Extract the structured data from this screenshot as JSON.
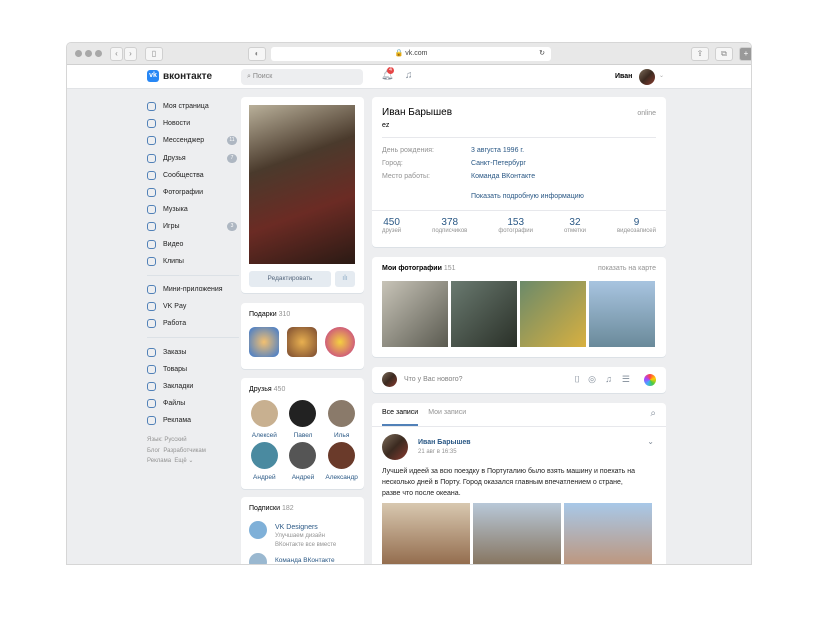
{
  "browser": {
    "url": "vk.com"
  },
  "header": {
    "logo": "вконтакте",
    "search_placeholder": "Поиск",
    "notifications": "4",
    "user": "Иван"
  },
  "sidebar": {
    "items": [
      {
        "label": "Моя страница"
      },
      {
        "label": "Новости"
      },
      {
        "label": "Мессенджер",
        "count": "11"
      },
      {
        "label": "Друзья",
        "count": "7"
      },
      {
        "label": "Сообщества"
      },
      {
        "label": "Фотографии"
      },
      {
        "label": "Музыка"
      },
      {
        "label": "Игры",
        "count": "3"
      },
      {
        "label": "Видео"
      },
      {
        "label": "Клипы"
      }
    ],
    "items2": [
      {
        "label": "Мини-приложения"
      },
      {
        "label": "VK Pay"
      },
      {
        "label": "Работа"
      }
    ],
    "items3": [
      {
        "label": "Заказы"
      },
      {
        "label": "Товары"
      },
      {
        "label": "Закладки"
      },
      {
        "label": "Файлы"
      },
      {
        "label": "Реклама"
      }
    ],
    "footer": {
      "lang": "Язык: Русский",
      "blog": "Блог",
      "dev": "Разработчикам",
      "ads": "Реклама",
      "more": "Ещё ⌄"
    }
  },
  "profile": {
    "edit": "Редактировать",
    "name": "Иван Барышев",
    "status": "ez",
    "online": "online",
    "info": [
      {
        "k": "День рождения:",
        "v": "3 августа 1996 г."
      },
      {
        "k": "Город:",
        "v": "Санкт-Петербург"
      },
      {
        "k": "Место работы:",
        "v": "Команда ВКонтакте"
      }
    ],
    "more": "Показать подробную информацию",
    "counters": [
      {
        "n": "450",
        "l": "друзей"
      },
      {
        "n": "378",
        "l": "подписчиков"
      },
      {
        "n": "153",
        "l": "фотографии"
      },
      {
        "n": "32",
        "l": "отметки"
      },
      {
        "n": "9",
        "l": "видеозаписей"
      }
    ]
  },
  "gifts": {
    "title": "Подарки",
    "count": "310"
  },
  "friends": {
    "title": "Друзья",
    "count": "450",
    "list": [
      "Алексей",
      "Павел",
      "Илья",
      "Андрей",
      "Андрей",
      "Александр"
    ]
  },
  "subs": {
    "title": "Подписки",
    "count": "182",
    "list": [
      {
        "name": "VK Designers",
        "desc1": "Улучшаем дизайн",
        "desc2": "ВКонтакте все вместе"
      },
      {
        "name": "Команда ВКонтакте"
      }
    ]
  },
  "photos": {
    "title": "Мои фотографии",
    "count": "151",
    "map": "показать на карте"
  },
  "composer": {
    "placeholder": "Что у Вас нового?"
  },
  "feed": {
    "tabs": [
      "Все записи",
      "Мои записи"
    ],
    "post": {
      "author": "Иван Барышев",
      "date": "21 авг в 16:35",
      "text": "Лучшей идеей за всю поездку в Португалию было взять машину и поехать на несколько дней в Порту. Город оказался главным впечатлением о стране, разве что после океана."
    }
  }
}
